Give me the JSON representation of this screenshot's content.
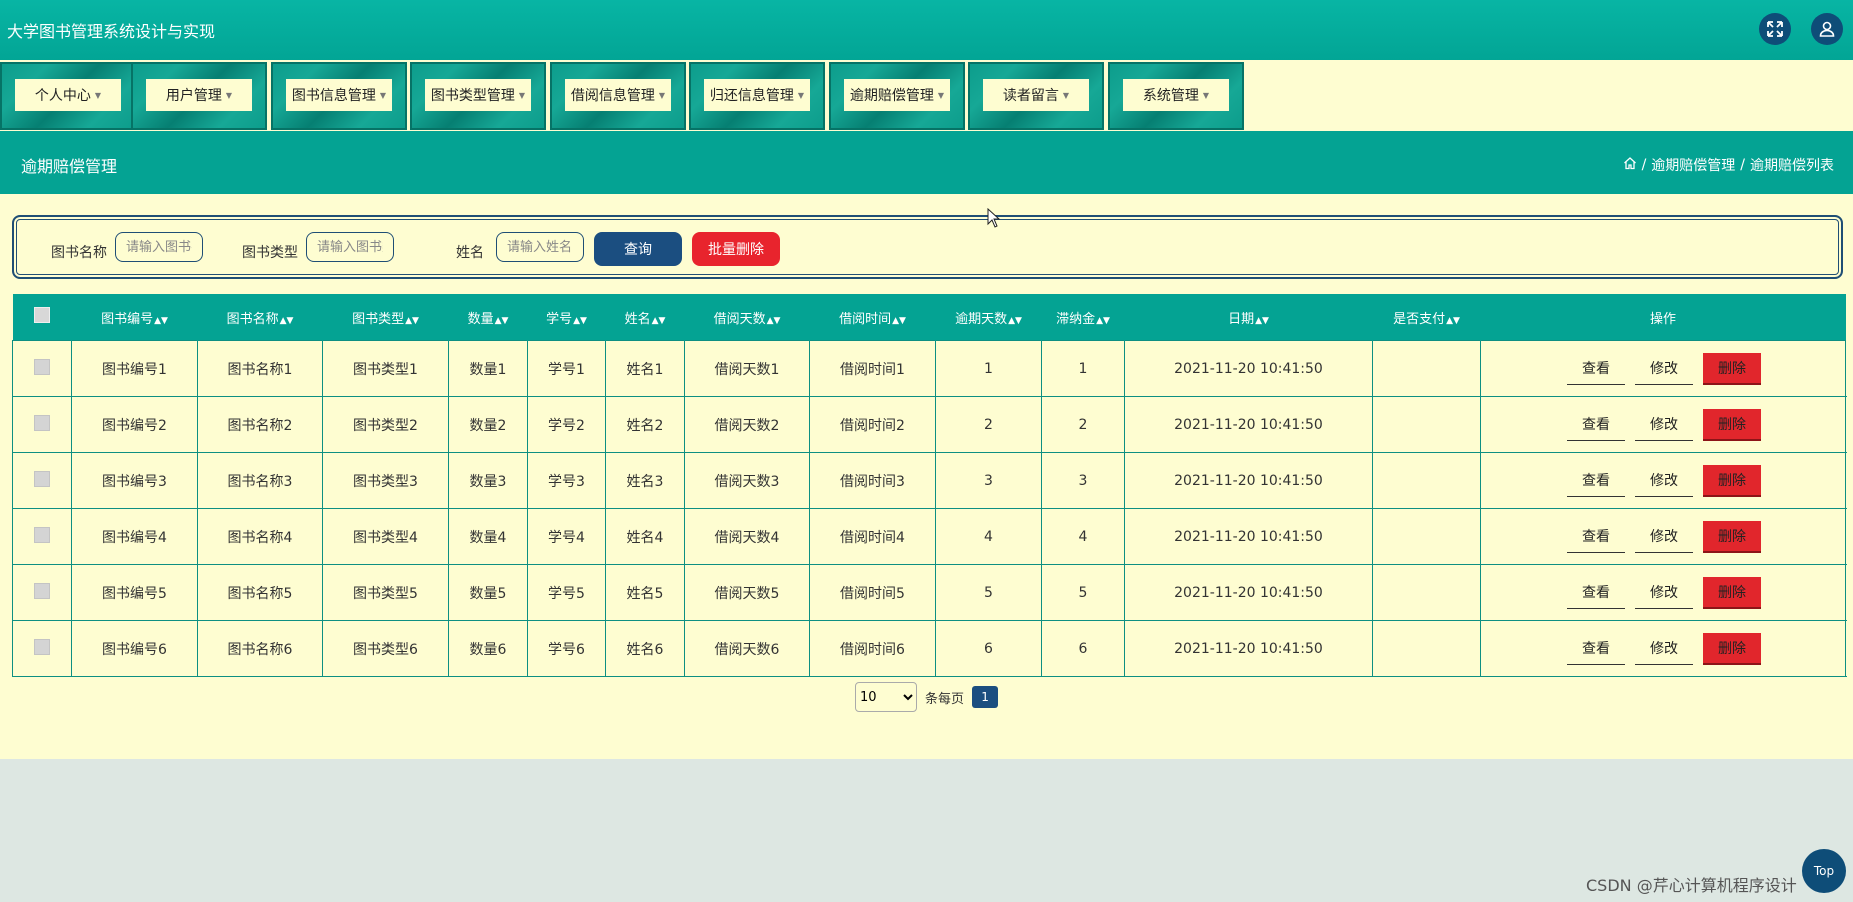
{
  "app": {
    "title": "大学图书管理系统设计与实现"
  },
  "nav": [
    {
      "label": "个人中心"
    },
    {
      "label": "用户管理"
    },
    {
      "label": "图书信息管理"
    },
    {
      "label": "图书类型管理"
    },
    {
      "label": "借阅信息管理"
    },
    {
      "label": "归还信息管理"
    },
    {
      "label": "逾期赔偿管理"
    },
    {
      "label": "读者留言"
    },
    {
      "label": "系统管理"
    }
  ],
  "page": {
    "title": "逾期赔偿管理",
    "crumb1": "逾期赔偿管理",
    "crumb2": "逾期赔偿列表",
    "sep": "/"
  },
  "search": {
    "bookname_label": "图书名称",
    "bookname_placeholder": "请输入图书名称",
    "booktype_label": "图书类型",
    "booktype_placeholder": "请输入图书类型",
    "name_label": "姓名",
    "name_placeholder": "请输入姓名",
    "query_label": "查询",
    "batch_delete_label": "批量删除"
  },
  "table": {
    "headers": [
      "图书编号",
      "图书名称",
      "图书类型",
      "数量",
      "学号",
      "姓名",
      "借阅天数",
      "借阅时间",
      "逾期天数",
      "滞纳金",
      "日期",
      "是否支付",
      "操作"
    ],
    "rows": [
      {
        "c": [
          "图书编号1",
          "图书名称1",
          "图书类型1",
          "数量1",
          "学号1",
          "姓名1",
          "借阅天数1",
          "借阅时间1",
          "1",
          "1",
          "2021-11-20 10:41:50",
          ""
        ]
      },
      {
        "c": [
          "图书编号2",
          "图书名称2",
          "图书类型2",
          "数量2",
          "学号2",
          "姓名2",
          "借阅天数2",
          "借阅时间2",
          "2",
          "2",
          "2021-11-20 10:41:50",
          ""
        ]
      },
      {
        "c": [
          "图书编号3",
          "图书名称3",
          "图书类型3",
          "数量3",
          "学号3",
          "姓名3",
          "借阅天数3",
          "借阅时间3",
          "3",
          "3",
          "2021-11-20 10:41:50",
          ""
        ]
      },
      {
        "c": [
          "图书编号4",
          "图书名称4",
          "图书类型4",
          "数量4",
          "学号4",
          "姓名4",
          "借阅天数4",
          "借阅时间4",
          "4",
          "4",
          "2021-11-20 10:41:50",
          ""
        ]
      },
      {
        "c": [
          "图书编号5",
          "图书名称5",
          "图书类型5",
          "数量5",
          "学号5",
          "姓名5",
          "借阅天数5",
          "借阅时间5",
          "5",
          "5",
          "2021-11-20 10:41:50",
          ""
        ]
      },
      {
        "c": [
          "图书编号6",
          "图书名称6",
          "图书类型6",
          "数量6",
          "学号6",
          "姓名6",
          "借阅天数6",
          "借阅时间6",
          "6",
          "6",
          "2021-11-20 10:41:50",
          ""
        ]
      }
    ],
    "actions": {
      "view": "查看",
      "edit": "修改",
      "delete": "删除"
    }
  },
  "pager": {
    "page_size": "10",
    "per_page_label": "条每页",
    "current_page": "1"
  },
  "footer": {
    "watermark": "CSDN @芹心计算机程序设计",
    "top_label": "Top"
  },
  "colors": {
    "teal": "#04a393",
    "cream": "#fefdd1",
    "navy": "#1b4e80",
    "red": "#e1262c"
  },
  "icons": {
    "fullscreen": "fullscreen-icon",
    "user": "user-icon",
    "home": "home-icon"
  }
}
